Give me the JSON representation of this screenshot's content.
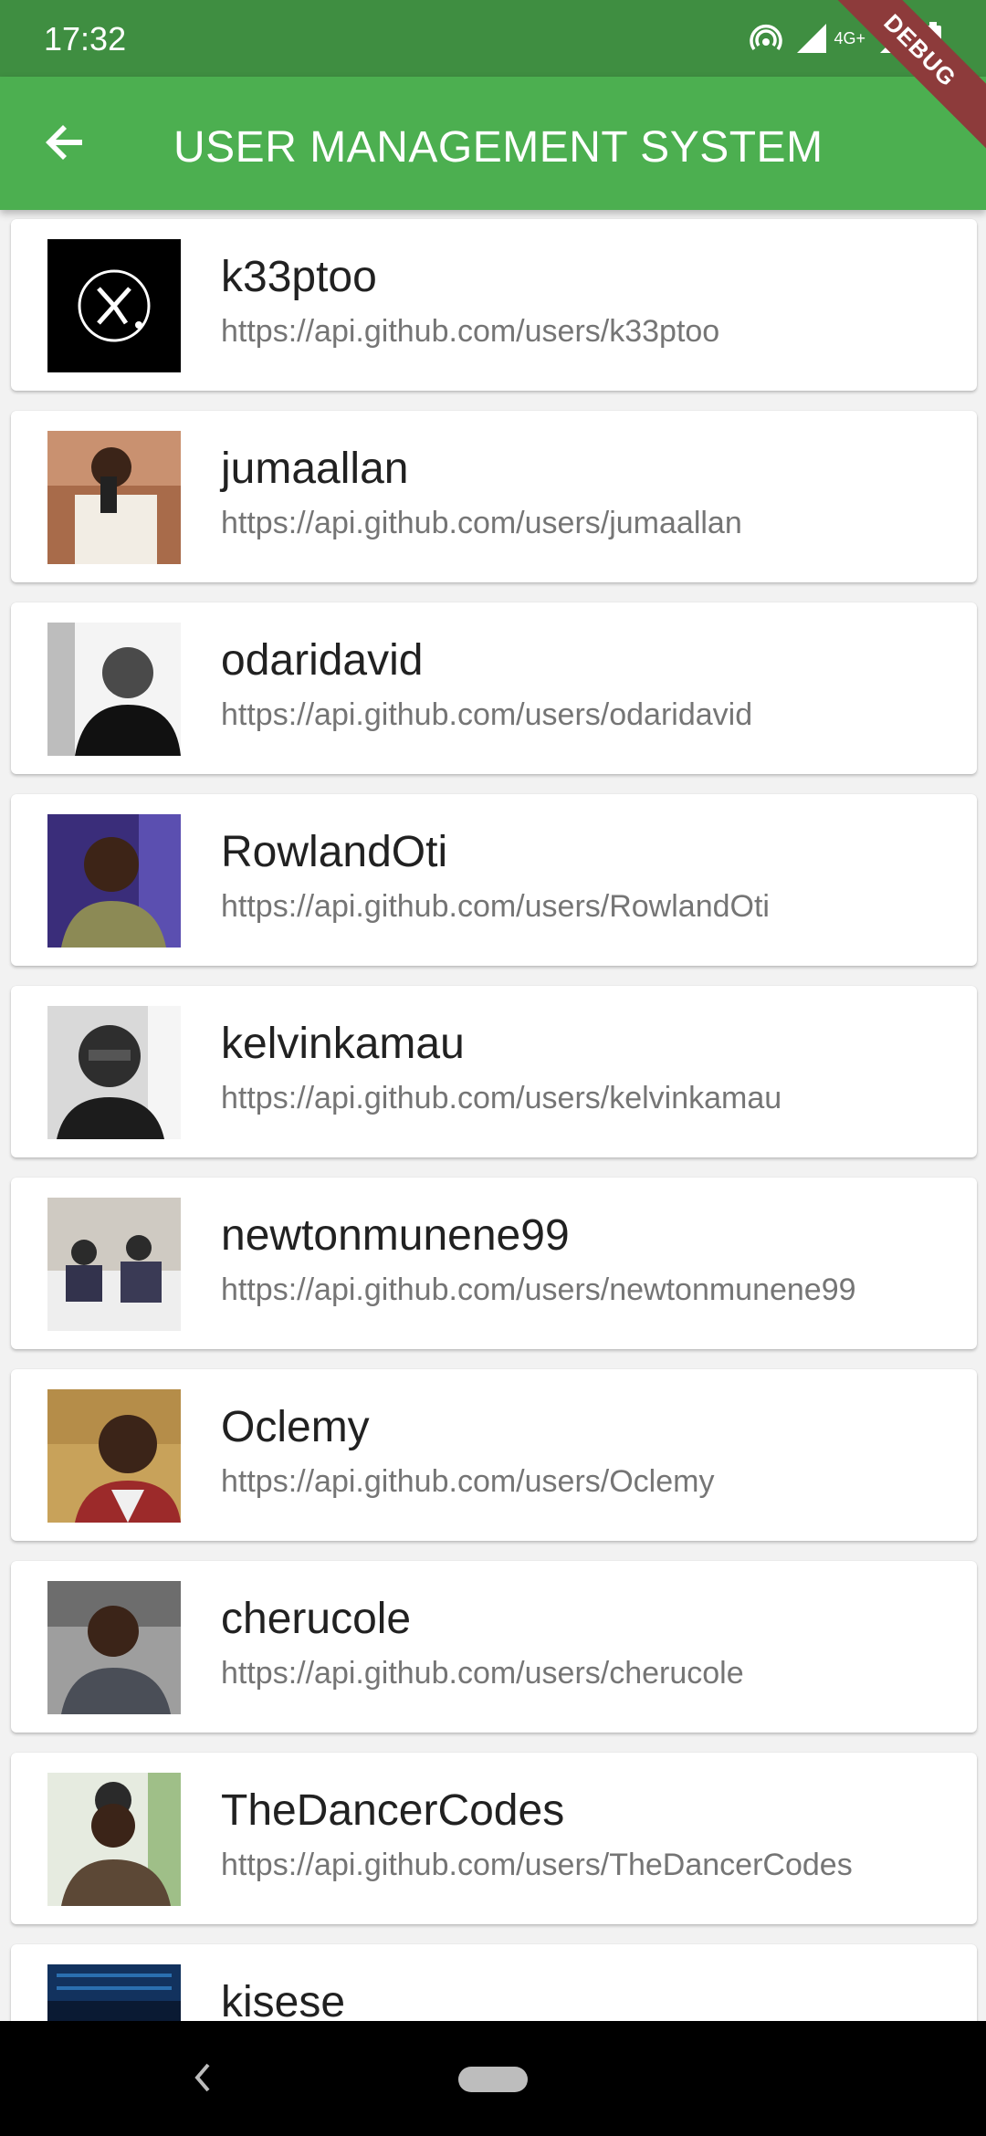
{
  "status_bar": {
    "time": "17:32",
    "network_label": "4G+",
    "icons": [
      "hotspot-icon",
      "signal-icon",
      "4g-plus-icon",
      "signal-icon",
      "battery-icon"
    ]
  },
  "debug_banner": {
    "label": "DEBUG"
  },
  "app_bar": {
    "title": "USER MANAGEMENT SYSTEM",
    "back_icon": "arrow-back-icon",
    "color": "#4caf50",
    "status_color": "#3f8e41"
  },
  "users": [
    {
      "login": "k33ptoo",
      "url": "https://api.github.com/users/k33ptoo"
    },
    {
      "login": "jumaallan",
      "url": "https://api.github.com/users/jumaallan"
    },
    {
      "login": "odaridavid",
      "url": "https://api.github.com/users/odaridavid"
    },
    {
      "login": "RowlandOti",
      "url": "https://api.github.com/users/RowlandOti"
    },
    {
      "login": "kelvinkamau",
      "url": "https://api.github.com/users/kelvinkamau"
    },
    {
      "login": "newtonmunene99",
      "url": "https://api.github.com/users/newtonmunene99"
    },
    {
      "login": "Oclemy",
      "url": "https://api.github.com/users/Oclemy"
    },
    {
      "login": "cherucole",
      "url": "https://api.github.com/users/cherucole"
    },
    {
      "login": "TheDancerCodes",
      "url": "https://api.github.com/users/TheDancerCodes"
    },
    {
      "login": "kisese",
      "url": ""
    }
  ],
  "nav_bar": {
    "icons": [
      "nav-back-icon",
      "nav-home-pill"
    ]
  }
}
